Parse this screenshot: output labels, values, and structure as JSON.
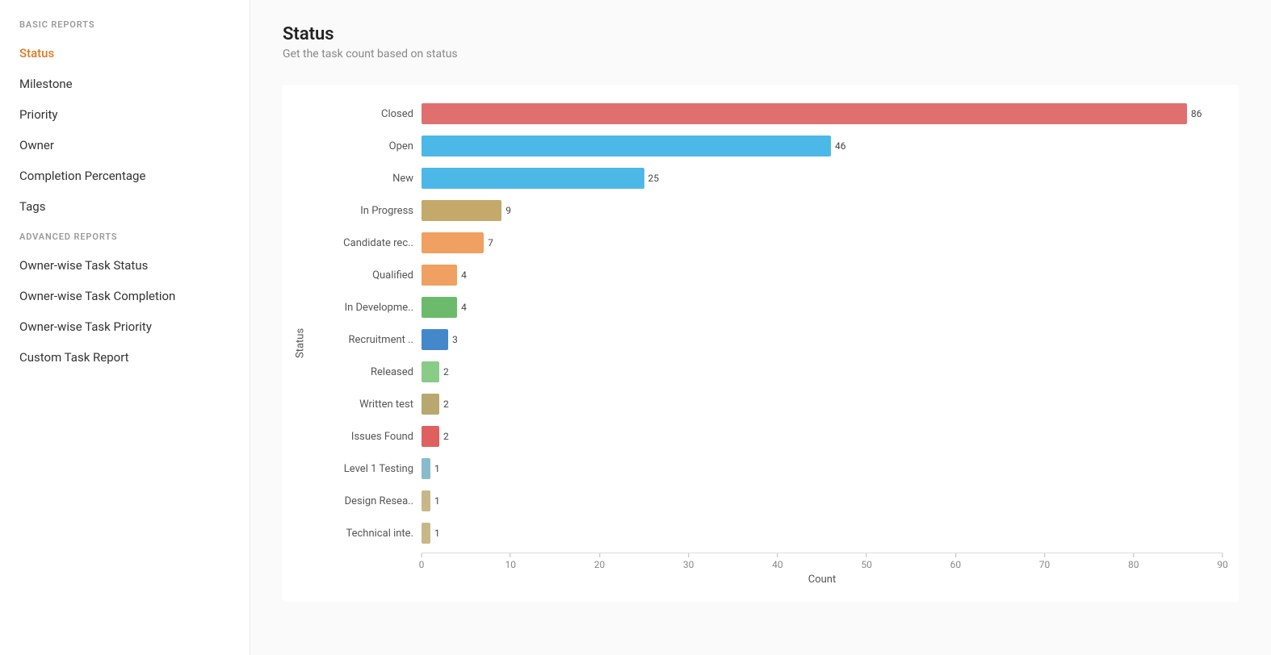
{
  "sidebar": {
    "basic_reports_label": "BASIC REPORTS",
    "advanced_reports_label": "ADVANCED REPORTS",
    "items_basic": [
      {
        "label": "Status",
        "id": "status",
        "active": true
      },
      {
        "label": "Milestone",
        "id": "milestone",
        "active": false
      },
      {
        "label": "Priority",
        "id": "priority",
        "active": false
      },
      {
        "label": "Owner",
        "id": "owner",
        "active": false
      },
      {
        "label": "Completion Percentage",
        "id": "completion",
        "active": false
      },
      {
        "label": "Tags",
        "id": "tags",
        "active": false
      }
    ],
    "items_advanced": [
      {
        "label": "Owner-wise Task Status",
        "id": "owner-status",
        "active": false
      },
      {
        "label": "Owner-wise Task Completion",
        "id": "owner-completion",
        "active": false
      },
      {
        "label": "Owner-wise Task Priority",
        "id": "owner-priority",
        "active": false
      },
      {
        "label": "Custom Task Report",
        "id": "custom",
        "active": false
      }
    ]
  },
  "page": {
    "title": "Status",
    "subtitle": "Get the task count based on status",
    "y_axis_label": "Status",
    "x_axis_label": "Count"
  },
  "chart": {
    "max_value": 90,
    "x_ticks": [
      0,
      10,
      20,
      30,
      40,
      50,
      60,
      70,
      80,
      90
    ],
    "bars": [
      {
        "label": "Closed",
        "value": 86,
        "color": "#e07070"
      },
      {
        "label": "Open",
        "value": 46,
        "color": "#4bb8e8"
      },
      {
        "label": "New",
        "value": 25,
        "color": "#4bb8e8"
      },
      {
        "label": "In Progress",
        "value": 9,
        "color": "#c4a96a"
      },
      {
        "label": "Candidate rec..",
        "value": 7,
        "color": "#f0a060"
      },
      {
        "label": "Qualified",
        "value": 4,
        "color": "#f0a060"
      },
      {
        "label": "In Developme..",
        "value": 4,
        "color": "#6cbb6c"
      },
      {
        "label": "Recruitment ..",
        "value": 3,
        "color": "#4488cc"
      },
      {
        "label": "Released",
        "value": 2,
        "color": "#88cc88"
      },
      {
        "label": "Written test",
        "value": 2,
        "color": "#b8a870"
      },
      {
        "label": "Issues Found",
        "value": 2,
        "color": "#e06060"
      },
      {
        "label": "Level 1 Testing",
        "value": 1,
        "color": "#88bbcc"
      },
      {
        "label": "Design Resea..",
        "value": 1,
        "color": "#c8b888"
      },
      {
        "label": "Technical inte.",
        "value": 1,
        "color": "#c8b888"
      }
    ]
  }
}
